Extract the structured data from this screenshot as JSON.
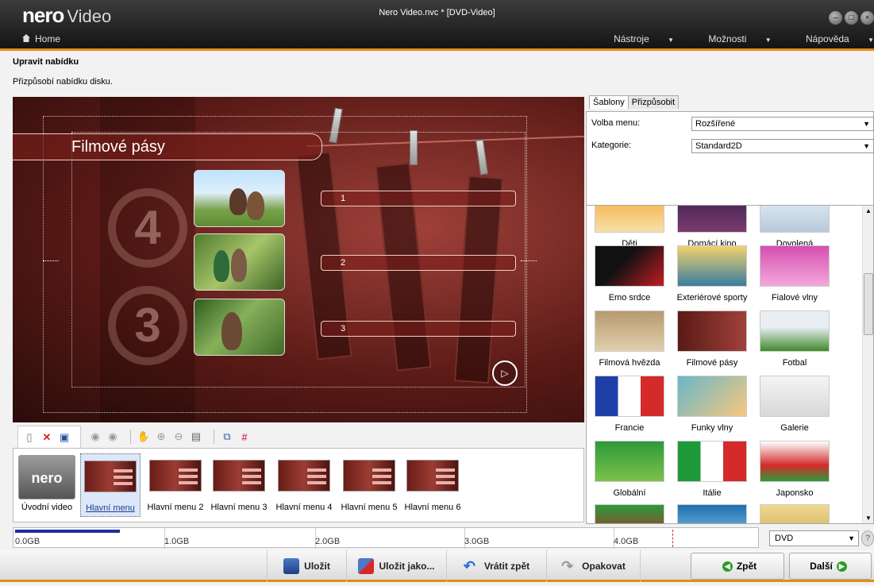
{
  "app": {
    "brand": "nero",
    "product": "Video",
    "doc_title": "Nero Video.nvc * [DVD-Video]",
    "home_label": "Home",
    "menus": [
      "Nástroje",
      "Možnosti",
      "Nápověda"
    ],
    "accent_color": "#e38a1c"
  },
  "section": {
    "title": "Upravit nabídku",
    "subtitle": "Přizpůsobí nabídku disku."
  },
  "preview": {
    "menu_title": "Filmové pásy",
    "buttons": [
      "1",
      "2",
      "3"
    ],
    "reels": [
      "4",
      "3"
    ],
    "play_icon": "play-icon"
  },
  "toolbar": {
    "icons": [
      "new-page-icon",
      "delete-icon",
      "save-icon",
      "disc-icon",
      "disc-icon",
      "hand-icon",
      "zoom-in-icon",
      "zoom-out-icon",
      "layout-icon",
      "arrange-icon",
      "grid-icon"
    ]
  },
  "menu_strip": {
    "items": [
      {
        "label": "Úvodní video",
        "thumb_text": "nero"
      },
      {
        "label": "Hlavní menu"
      },
      {
        "label": "Hlavní menu 2"
      },
      {
        "label": "Hlavní menu 3"
      },
      {
        "label": "Hlavní menu 4"
      },
      {
        "label": "Hlavní menu 5"
      },
      {
        "label": "Hlavní menu 6"
      }
    ],
    "selected_index": 1
  },
  "right_panel": {
    "tabs": [
      "Šablony",
      "Přizpůsobit"
    ],
    "active_tab": 0,
    "menu_choice_label": "Volba menu:",
    "menu_choice_value": "Rozšířené",
    "category_label": "Kategorie:",
    "category_value": "Standard2D",
    "templates": [
      {
        "label": "Děti"
      },
      {
        "label": "Domácí kino"
      },
      {
        "label": "Dovolená"
      },
      {
        "label": "Emo srdce"
      },
      {
        "label": "Exteriérové sporty"
      },
      {
        "label": "Fialové vlny"
      },
      {
        "label": "Filmová hvězda"
      },
      {
        "label": "Filmové pásy"
      },
      {
        "label": "Fotbal"
      },
      {
        "label": "Francie"
      },
      {
        "label": "Funky vlny"
      },
      {
        "label": "Galerie"
      },
      {
        "label": "Globální"
      },
      {
        "label": "Itálie"
      },
      {
        "label": "Japonsko"
      }
    ]
  },
  "capacity": {
    "labels": [
      "0.0GB",
      "1.0GB",
      "2.0GB",
      "3.0GB",
      "4.0GB"
    ],
    "used_fraction": 0.14,
    "disc_type": "DVD"
  },
  "bottom_bar": {
    "save": "Uložit",
    "save_as": "Uložit jako...",
    "undo": "Vrátit zpět",
    "redo": "Opakovat",
    "back": "Zpět",
    "next": "Další"
  }
}
